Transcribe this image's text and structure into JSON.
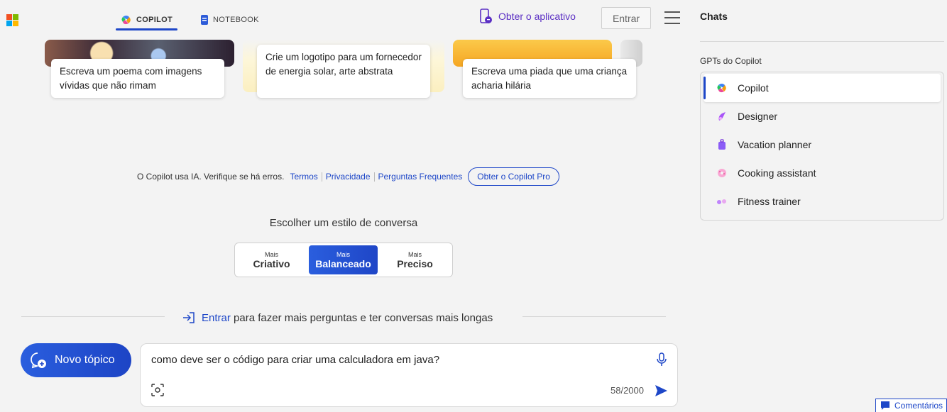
{
  "header": {
    "tabs": [
      {
        "label": "COPILOT",
        "active": true
      },
      {
        "label": "NOTEBOOK",
        "active": false
      }
    ],
    "get_app": "Obter o aplicativo",
    "signin": "Entrar"
  },
  "suggestions": [
    "Escreva um poema com imagens vívidas que não rimam",
    "Crie um logotipo para um fornecedor de energia solar, arte abstrata",
    "Escreva uma piada que uma criança acharia hilária"
  ],
  "disclaimer": {
    "text": "O Copilot usa IA. Verifique se há erros.",
    "links": [
      "Termos",
      "Privacidade",
      "Perguntas Frequentes"
    ],
    "pro_button": "Obter o Copilot Pro"
  },
  "conversation_style": {
    "title": "Escolher um estilo de conversa",
    "options": [
      {
        "small": "Mais",
        "big": "Criativo",
        "active": false
      },
      {
        "small": "Mais",
        "big": "Balanceado",
        "active": true
      },
      {
        "small": "Mais",
        "big": "Preciso",
        "active": false
      }
    ]
  },
  "signin_prompt": {
    "link": "Entrar",
    "text": "para fazer mais perguntas e ter conversas mais longas"
  },
  "composer": {
    "new_topic": "Novo tópico",
    "input_value": "como deve ser o código para criar uma calculadora em java?",
    "char_count": "58/2000"
  },
  "sidebar": {
    "title": "Chats",
    "gpts_title": "GPTs do Copilot",
    "items": [
      {
        "label": "Copilot",
        "icon": "copilot-icon",
        "active": true
      },
      {
        "label": "Designer",
        "icon": "designer-icon",
        "active": false
      },
      {
        "label": "Vacation planner",
        "icon": "suitcase-icon",
        "active": false
      },
      {
        "label": "Cooking assistant",
        "icon": "donut-icon",
        "active": false
      },
      {
        "label": "Fitness trainer",
        "icon": "dumbbell-icon",
        "active": false
      }
    ]
  },
  "feedback": "Comentários",
  "colors": {
    "accent": "#1e47c8",
    "app_purple": "#5b2fc4",
    "background": "#f3f3f3"
  }
}
